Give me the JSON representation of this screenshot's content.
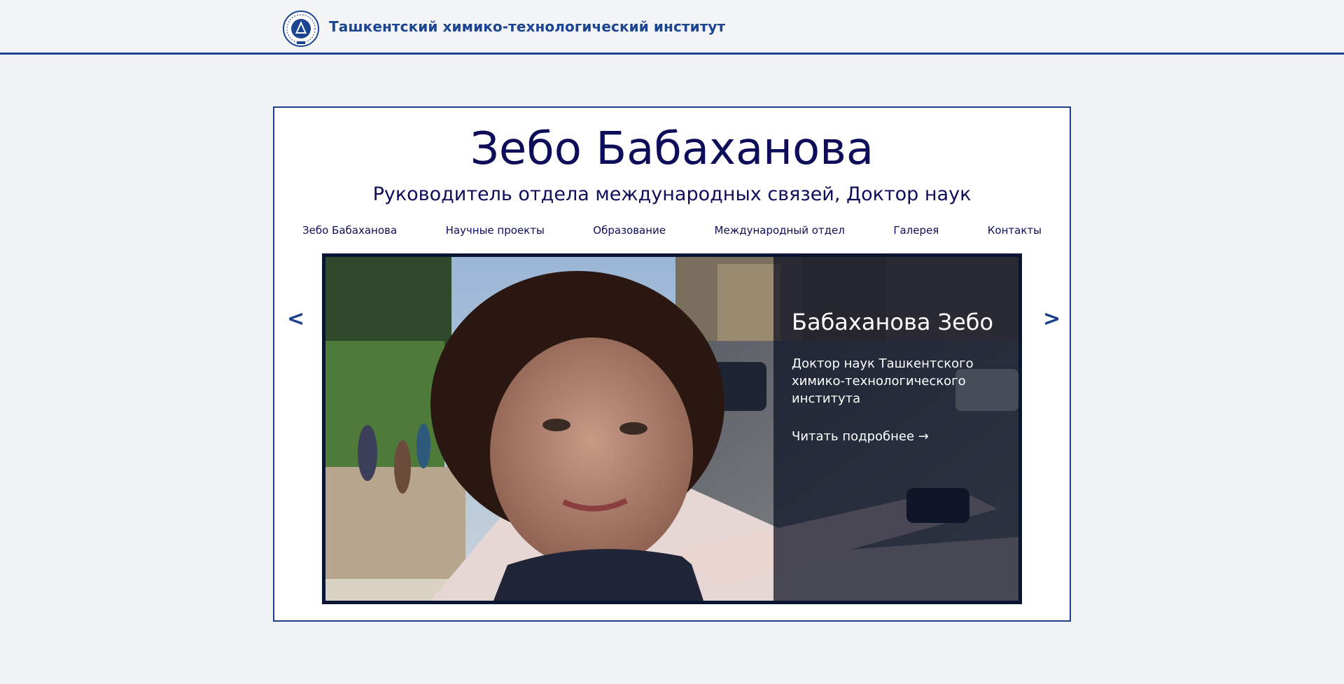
{
  "header": {
    "site_title": "Ташкентский химико-технологический институт",
    "accent_color": "#1b4590"
  },
  "profile": {
    "name": "Зебо Бабаханова",
    "position": "Руководитель отдела международных связей, Доктор наук"
  },
  "nav": {
    "items": [
      {
        "label": "Зебо Бабаханова"
      },
      {
        "label": "Научные проекты"
      },
      {
        "label": "Образование"
      },
      {
        "label": "Международный отдел"
      },
      {
        "label": "Галерея"
      },
      {
        "label": "Контакты"
      }
    ]
  },
  "slider": {
    "title": "Бабаханова Зебо",
    "description": "Доктор наук Ташкентского химико-технологического института",
    "read_more": "Читать подробнее →",
    "prev_label": "<",
    "next_label": ">"
  },
  "icons": {
    "logo": "institute-emblem-icon"
  }
}
